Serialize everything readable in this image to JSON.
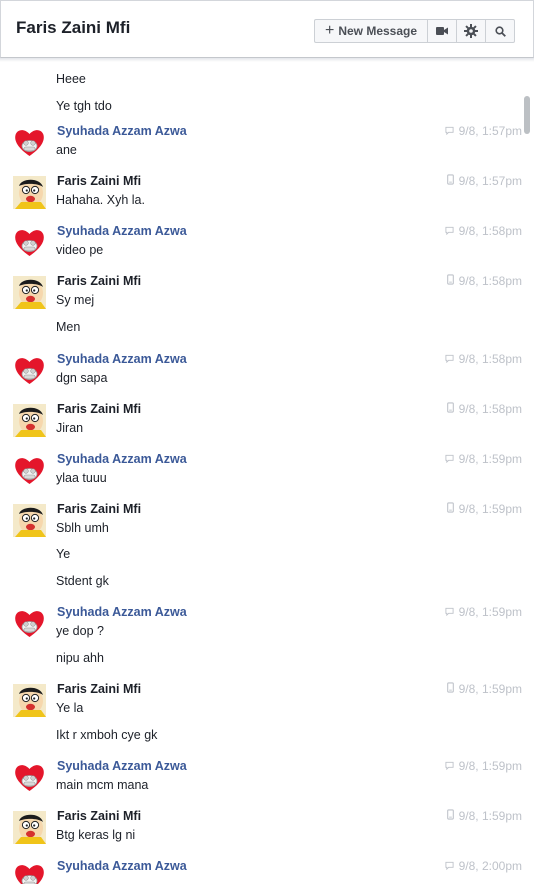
{
  "header": {
    "title": "Faris Zaini Mfi",
    "new_message_label": "New Message"
  },
  "colors": {
    "link_name": "#3b5998",
    "text": "#1d2129",
    "time": "#bec2c9"
  },
  "messages": [
    {
      "text": "Heee"
    },
    {
      "text": "Ye tgh tdo"
    },
    {
      "sender": "Syuhada Azzam Azwa",
      "time": "9/8, 1:57pm",
      "via": "chat",
      "text": "ane"
    },
    {
      "sender": "Faris Zaini Mfi",
      "time": "9/8, 1:57pm",
      "via": "mobile",
      "text": "Hahaha. Xyh la."
    },
    {
      "sender": "Syuhada Azzam Azwa",
      "time": "9/8, 1:58pm",
      "via": "chat",
      "text": "video pe"
    },
    {
      "sender": "Faris Zaini Mfi",
      "time": "9/8, 1:58pm",
      "via": "mobile",
      "text": "Sy mej"
    },
    {
      "text": "Men"
    },
    {
      "sender": "Syuhada Azzam Azwa",
      "time": "9/8, 1:58pm",
      "via": "chat",
      "text": "dgn sapa"
    },
    {
      "sender": "Faris Zaini Mfi",
      "time": "9/8, 1:58pm",
      "via": "mobile",
      "text": "Jiran"
    },
    {
      "sender": "Syuhada Azzam Azwa",
      "time": "9/8, 1:59pm",
      "via": "chat",
      "text": "ylaa tuuu"
    },
    {
      "sender": "Faris Zaini Mfi",
      "time": "9/8, 1:59pm",
      "via": "mobile",
      "text": "Sblh umh"
    },
    {
      "text": "Ye"
    },
    {
      "text": "Stdent gk"
    },
    {
      "sender": "Syuhada Azzam Azwa",
      "time": "9/8, 1:59pm",
      "via": "chat",
      "text": "ye dop ?"
    },
    {
      "text": "nipu ahh"
    },
    {
      "sender": "Faris Zaini Mfi",
      "time": "9/8, 1:59pm",
      "via": "mobile",
      "text": "Ye la"
    },
    {
      "text": "Ikt r xmboh cye gk"
    },
    {
      "sender": "Syuhada Azzam Azwa",
      "time": "9/8, 1:59pm",
      "via": "chat",
      "text": "main mcm mana"
    },
    {
      "sender": "Faris Zaini Mfi",
      "time": "9/8, 1:59pm",
      "via": "mobile",
      "text": "Btg keras lg ni"
    },
    {
      "sender": "Syuhada Azzam Azwa",
      "time": "9/8, 2:00pm",
      "via": "chat",
      "text": ""
    }
  ]
}
